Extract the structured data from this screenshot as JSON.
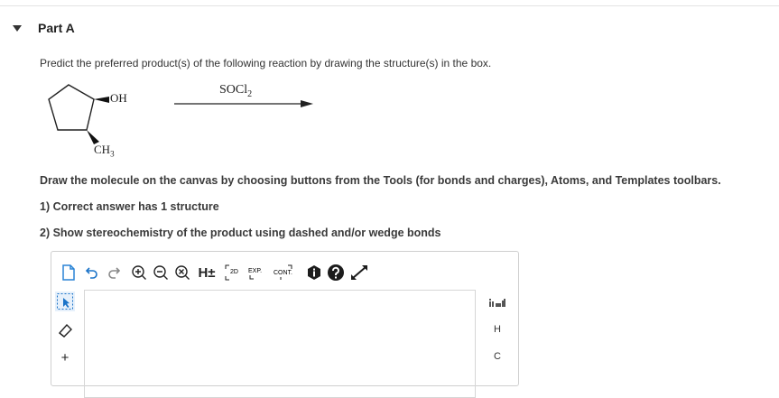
{
  "part": {
    "title": "Part A"
  },
  "question": {
    "instruction": "Predict the preferred product(s) of the following reaction by drawing the structure(s) in the box.",
    "reagent": "SOCl",
    "reagent_sub": "2",
    "group_oh": "OH",
    "group_ch3": "CH",
    "group_ch3_sub": "3"
  },
  "instructions": {
    "draw": "Draw the molecule on the canvas by choosing buttons from the Tools (for bonds and charges), Atoms, and Templates toolbars.",
    "note1": "1) Correct answer has 1 structure",
    "note2": "2) Show stereochemistry of the product using dashed and/or wedge bonds"
  },
  "toolbar": {
    "h_label": "H±",
    "label_2d": "2D",
    "label_exp": "EXP.",
    "label_cont": "CONT.",
    "tools": [
      "new-document-icon",
      "undo-icon",
      "redo-icon",
      "zoom-in-icon",
      "zoom-out-icon",
      "zoom-reset-icon",
      "h-toggle",
      "2d-clean-icon",
      "expand-icon",
      "contract-icon",
      "info-icon",
      "help-icon",
      "fullscreen-icon"
    ]
  },
  "left_toolbar": {
    "plus_label": "+",
    "tools": [
      "select-icon",
      "eraser-icon",
      "plus-charge-icon"
    ]
  },
  "right_toolbar": {
    "atoms": [
      "H",
      "C"
    ],
    "templates": "periodic-table-icon"
  },
  "colors": {
    "accent": "#1a73c8",
    "dark": "#1c1c1c",
    "border": "#cfcfcf"
  }
}
